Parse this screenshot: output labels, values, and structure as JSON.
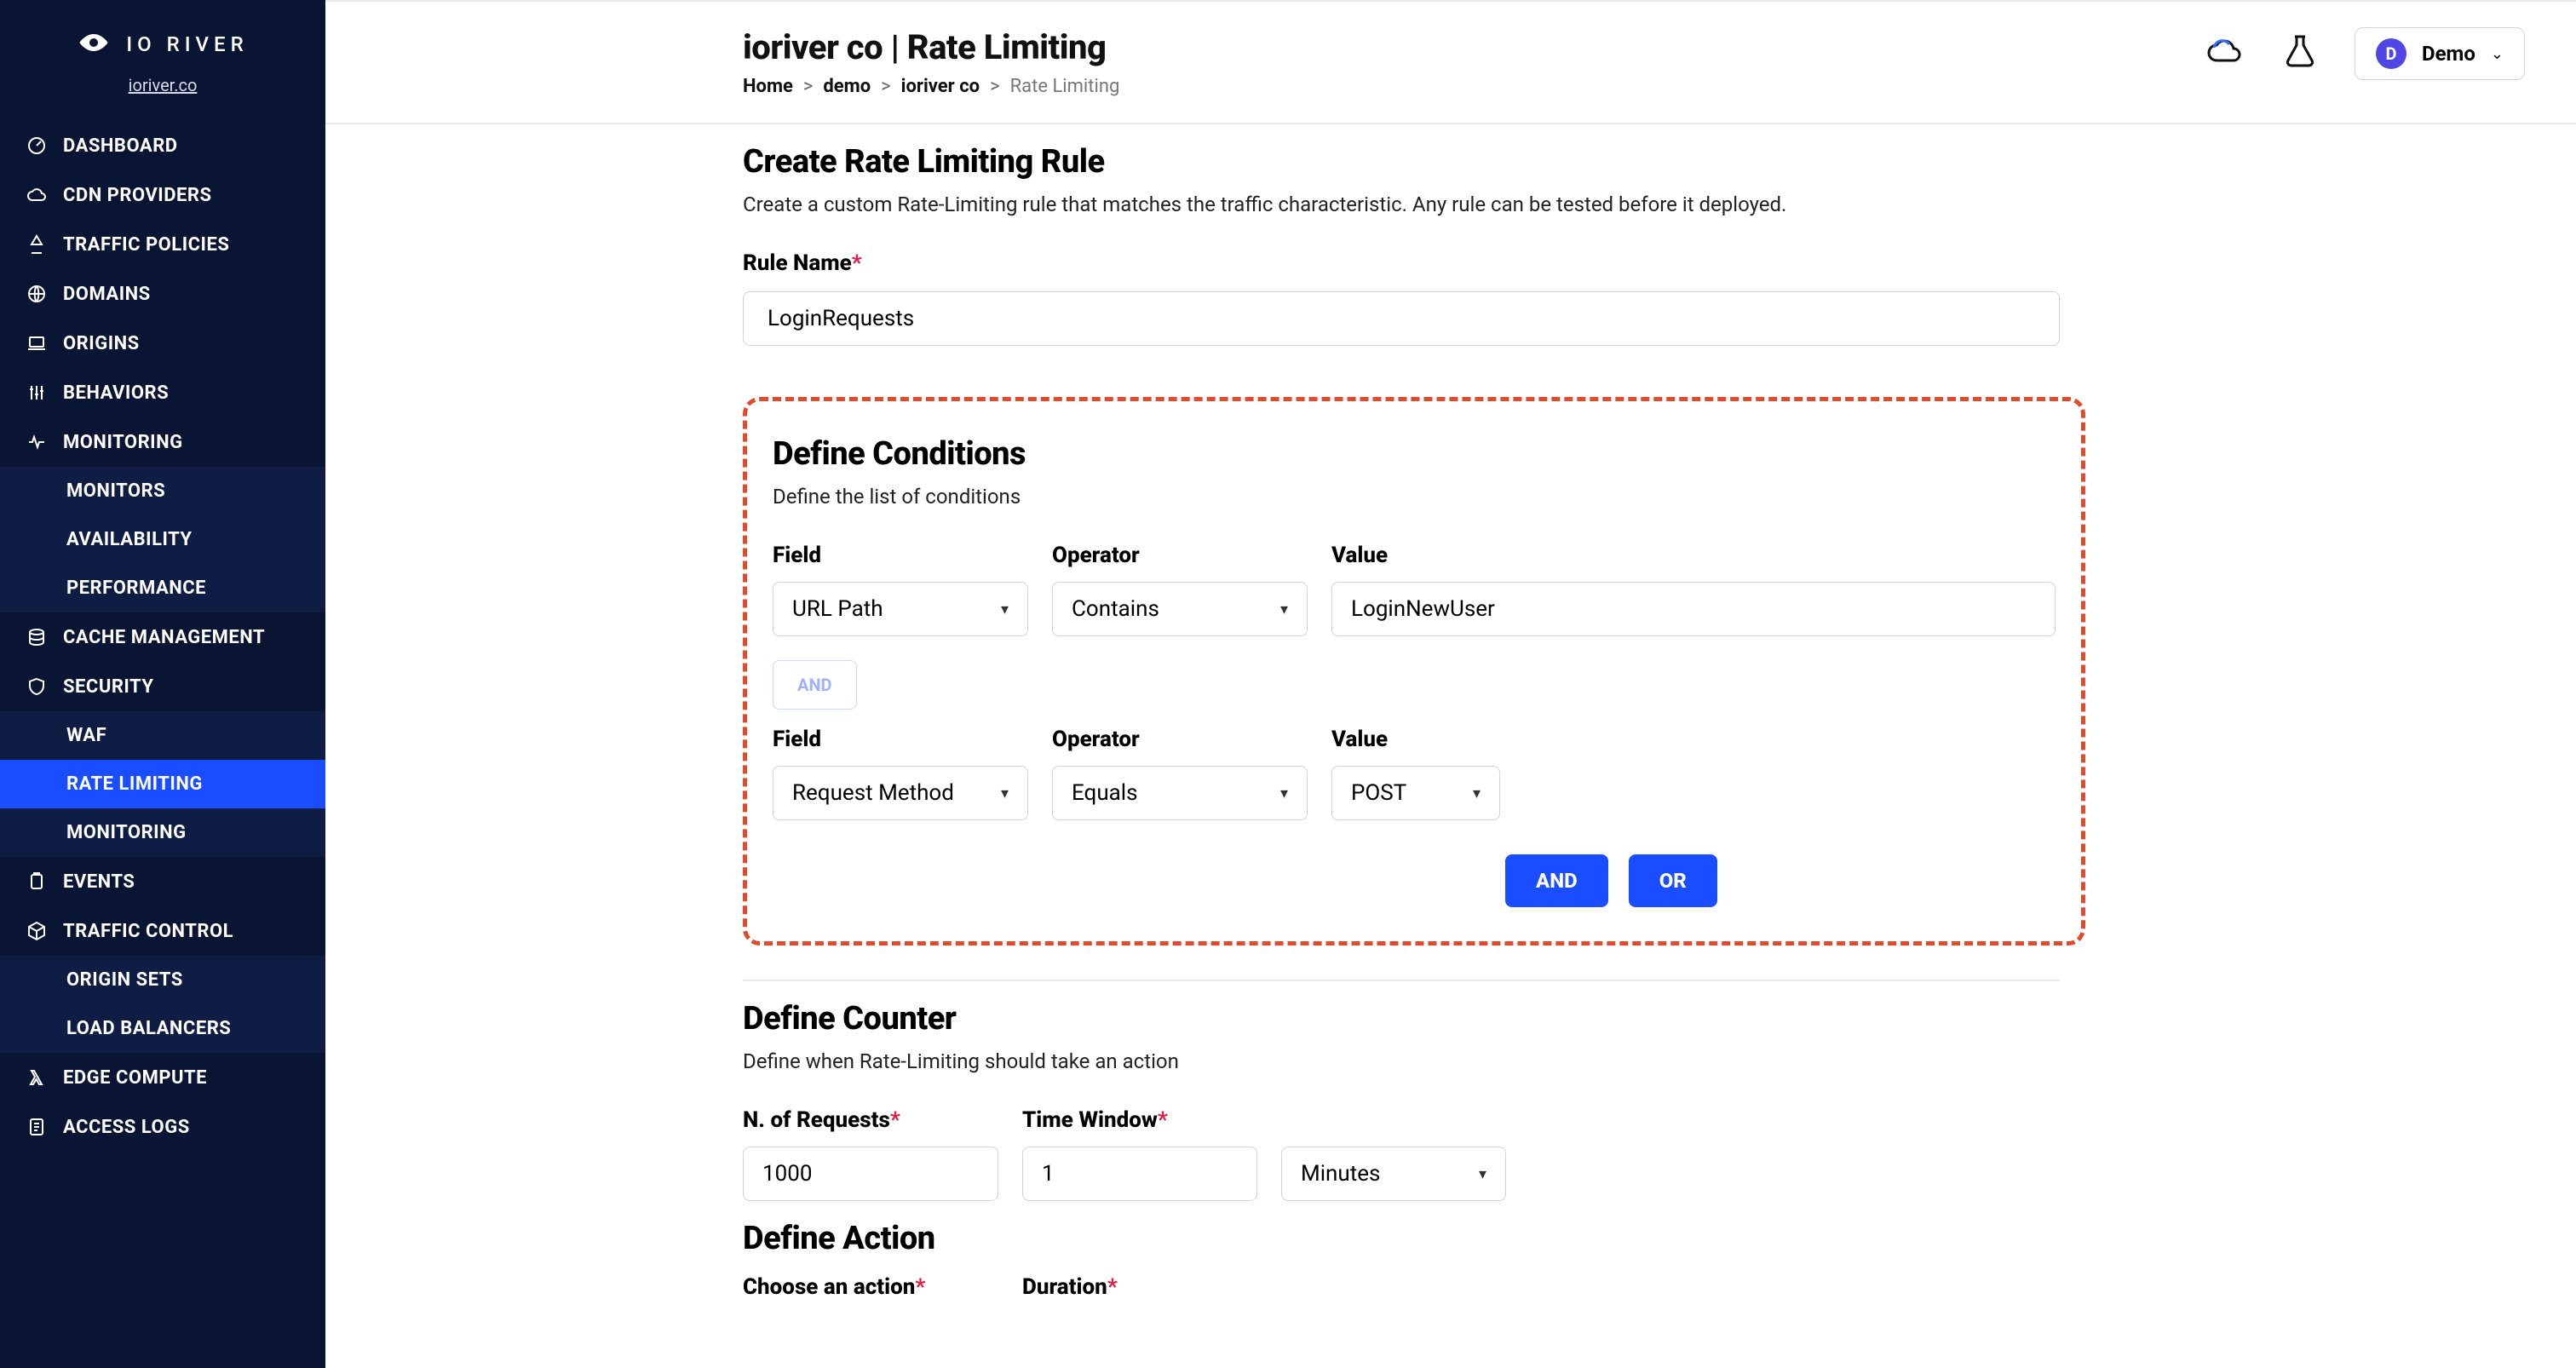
{
  "brand": {
    "name": "IO RIVER",
    "tenant": "ioriver.co"
  },
  "sidebar": {
    "items": [
      {
        "label": "DASHBOARD",
        "icon": "gauge"
      },
      {
        "label": "CDN PROVIDERS",
        "icon": "cloud"
      },
      {
        "label": "TRAFFIC POLICIES",
        "icon": "traffic"
      },
      {
        "label": "DOMAINS",
        "icon": "globe"
      },
      {
        "label": "ORIGINS",
        "icon": "laptop"
      },
      {
        "label": "BEHAVIORS",
        "icon": "sliders"
      },
      {
        "label": "MONITORING",
        "icon": "heartbeat"
      }
    ],
    "monitoring_children": [
      {
        "label": "MONITORS"
      },
      {
        "label": "AVAILABILITY"
      },
      {
        "label": "PERFORMANCE"
      }
    ],
    "items2": [
      {
        "label": "CACHE MANAGEMENT",
        "icon": "stack"
      },
      {
        "label": "SECURITY",
        "icon": "shield"
      }
    ],
    "security_children": [
      {
        "label": "WAF"
      },
      {
        "label": "RATE LIMITING",
        "active": true
      },
      {
        "label": "MONITORING"
      }
    ],
    "items3": [
      {
        "label": "EVENTS",
        "icon": "clipboard"
      },
      {
        "label": "TRAFFIC CONTROL",
        "icon": "cube"
      }
    ],
    "traffic_children": [
      {
        "label": "ORIGIN SETS"
      },
      {
        "label": "LOAD BALANCERS"
      }
    ],
    "items4": [
      {
        "label": "EDGE COMPUTE",
        "icon": "lambda"
      },
      {
        "label": "ACCESS LOGS",
        "icon": "log"
      }
    ]
  },
  "header": {
    "title": "ioriver co | Rate Limiting",
    "breadcrumbs": [
      "Home",
      "demo",
      "ioriver co",
      "Rate Limiting"
    ],
    "user": {
      "initial": "D",
      "name": "Demo"
    }
  },
  "create": {
    "title": "Create Rate Limiting Rule",
    "desc": "Create a custom Rate-Limiting rule that matches the traffic characteristic. Any rule can be tested before it deployed.",
    "rule_name_label": "Rule Name",
    "rule_name_value": "LoginRequests"
  },
  "conditions": {
    "title": "Define Conditions",
    "desc": "Define the list of conditions",
    "labels": {
      "field": "Field",
      "operator": "Operator",
      "value": "Value"
    },
    "row1": {
      "field": "URL Path",
      "operator": "Contains",
      "value": "LoginNewUser"
    },
    "join_chip": "AND",
    "row2": {
      "field": "Request Method",
      "operator": "Equals",
      "value": "POST"
    },
    "buttons": {
      "and": "AND",
      "or": "OR"
    }
  },
  "counter": {
    "title": "Define Counter",
    "desc": "Define when Rate-Limiting should take an action",
    "labels": {
      "n": "N. of Requests",
      "window": "Time Window"
    },
    "n_value": "1000",
    "window_value": "1",
    "unit": "Minutes"
  },
  "action": {
    "title": "Define Action",
    "choose_label": "Choose an action",
    "duration_label": "Duration"
  }
}
